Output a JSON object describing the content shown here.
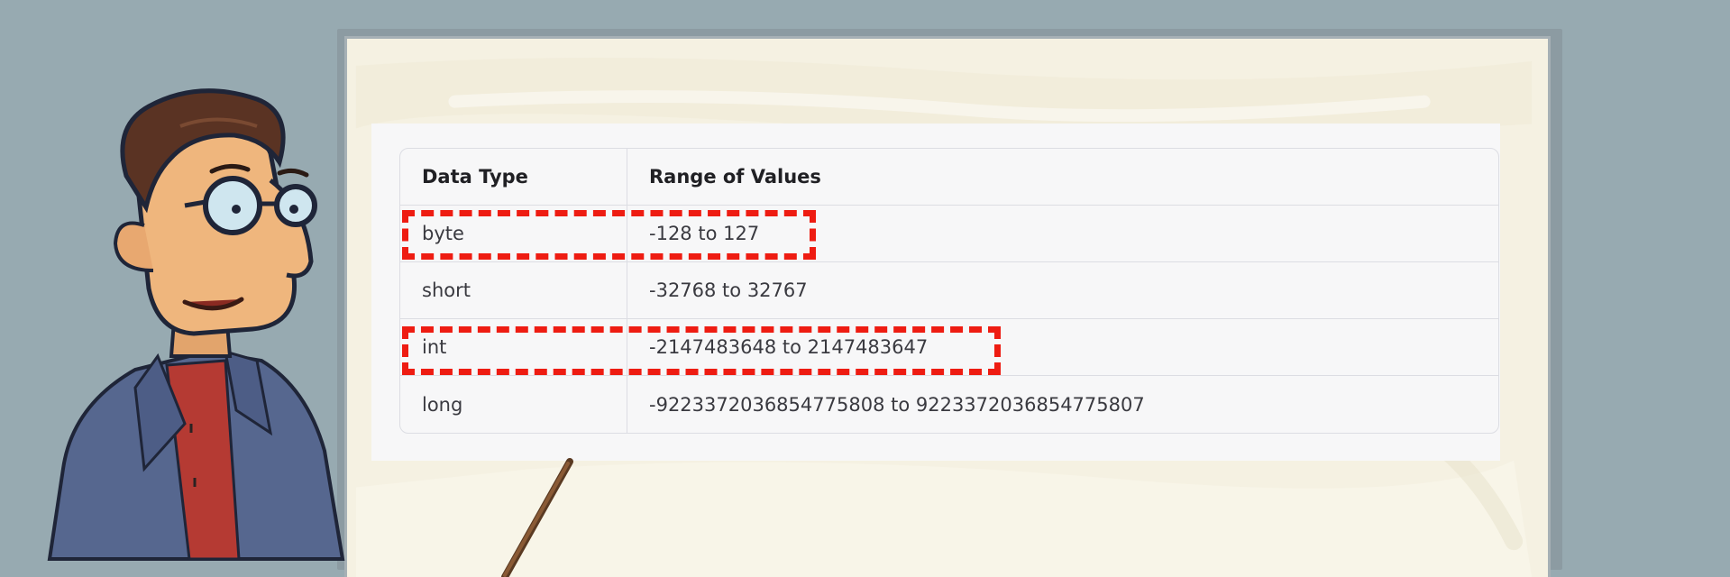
{
  "table": {
    "headers": [
      "Data Type",
      "Range of Values"
    ],
    "rows": [
      {
        "type": "byte",
        "range": "-128 to 127",
        "highlighted": true
      },
      {
        "type": "short",
        "range": "-32768 to 32767",
        "highlighted": false
      },
      {
        "type": "int",
        "range": "-2147483648 to 2147483647",
        "highlighted": true
      },
      {
        "type": "long",
        "range": "-9223372036854775808 to 9223372036854775807",
        "highlighted": false
      }
    ]
  },
  "colors": {
    "background": "#97aab1",
    "board": "#f6f2e4",
    "highlight": "#ee1c12",
    "table_bg": "#f7f7f8",
    "table_border": "#dcdde3"
  },
  "icons": [
    "teacher-illustration",
    "pointer-stick"
  ]
}
